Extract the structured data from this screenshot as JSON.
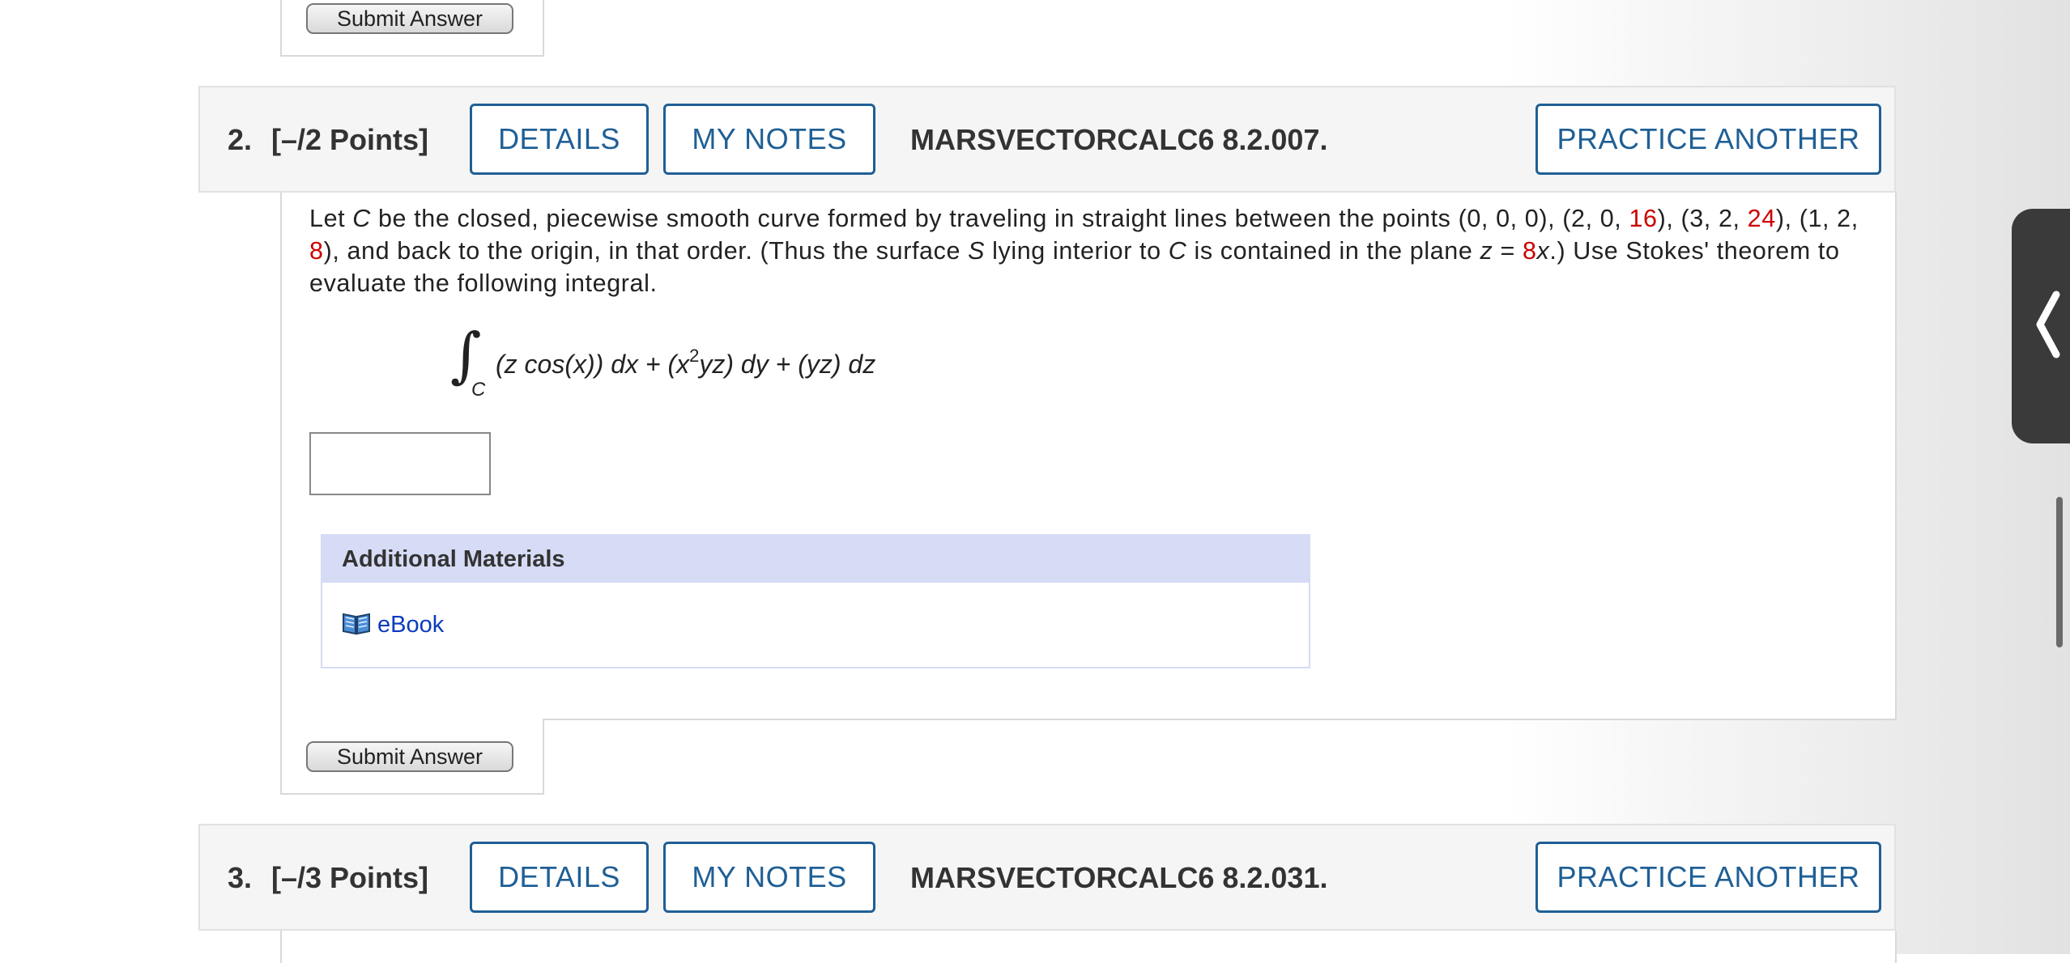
{
  "prev_question": {
    "submit_label": "Submit Answer"
  },
  "question2": {
    "number": "2.",
    "points": "[–/2 Points]",
    "details_label": "DETAILS",
    "notes_label": "MY NOTES",
    "code": "MARSVECTORCALC6 8.2.007.",
    "practice_label": "PRACTICE ANOTHER",
    "text": {
      "p1": "Let ",
      "c1": "C",
      "p2": " be the closed, piecewise smooth curve formed by traveling in straight lines between the points (0, 0, 0), (2, 0, ",
      "v1": "16",
      "p3": "), (3, 2, ",
      "v2": "24",
      "p4": "), (1, 2, ",
      "v3": "8",
      "p5": "), and back to the origin, in that order. (Thus the surface ",
      "s1": "S",
      "p6": " lying interior to ",
      "c2": "C",
      "p7": " is contained in the plane ",
      "z1": "z",
      "p8": " = ",
      "v4": "8",
      "x1": "x",
      "p9": ".) Use Stokes' theorem to evaluate the following integral."
    },
    "integral": {
      "sign": "∫",
      "subscript": "C",
      "expr_a": "(z cos(x)) dx + (x",
      "sup": "2",
      "expr_b": "yz) dy + (yz) dz"
    },
    "answer_value": "",
    "additional_materials": {
      "title": "Additional Materials",
      "ebook_label": "eBook",
      "ebook_icon": "open-book-icon"
    },
    "submit_label": "Submit Answer"
  },
  "question3": {
    "number": "3.",
    "points": "[–/3 Points]",
    "details_label": "DETAILS",
    "notes_label": "MY NOTES",
    "code": "MARSVECTORCALC6 8.2.031.",
    "practice_label": "PRACTICE ANOTHER"
  },
  "colors": {
    "accent_blue": "#1f5f95",
    "highlight_red": "#cc0000",
    "link_blue": "#0b3bbd",
    "materials_header": "#d6dcf5"
  }
}
